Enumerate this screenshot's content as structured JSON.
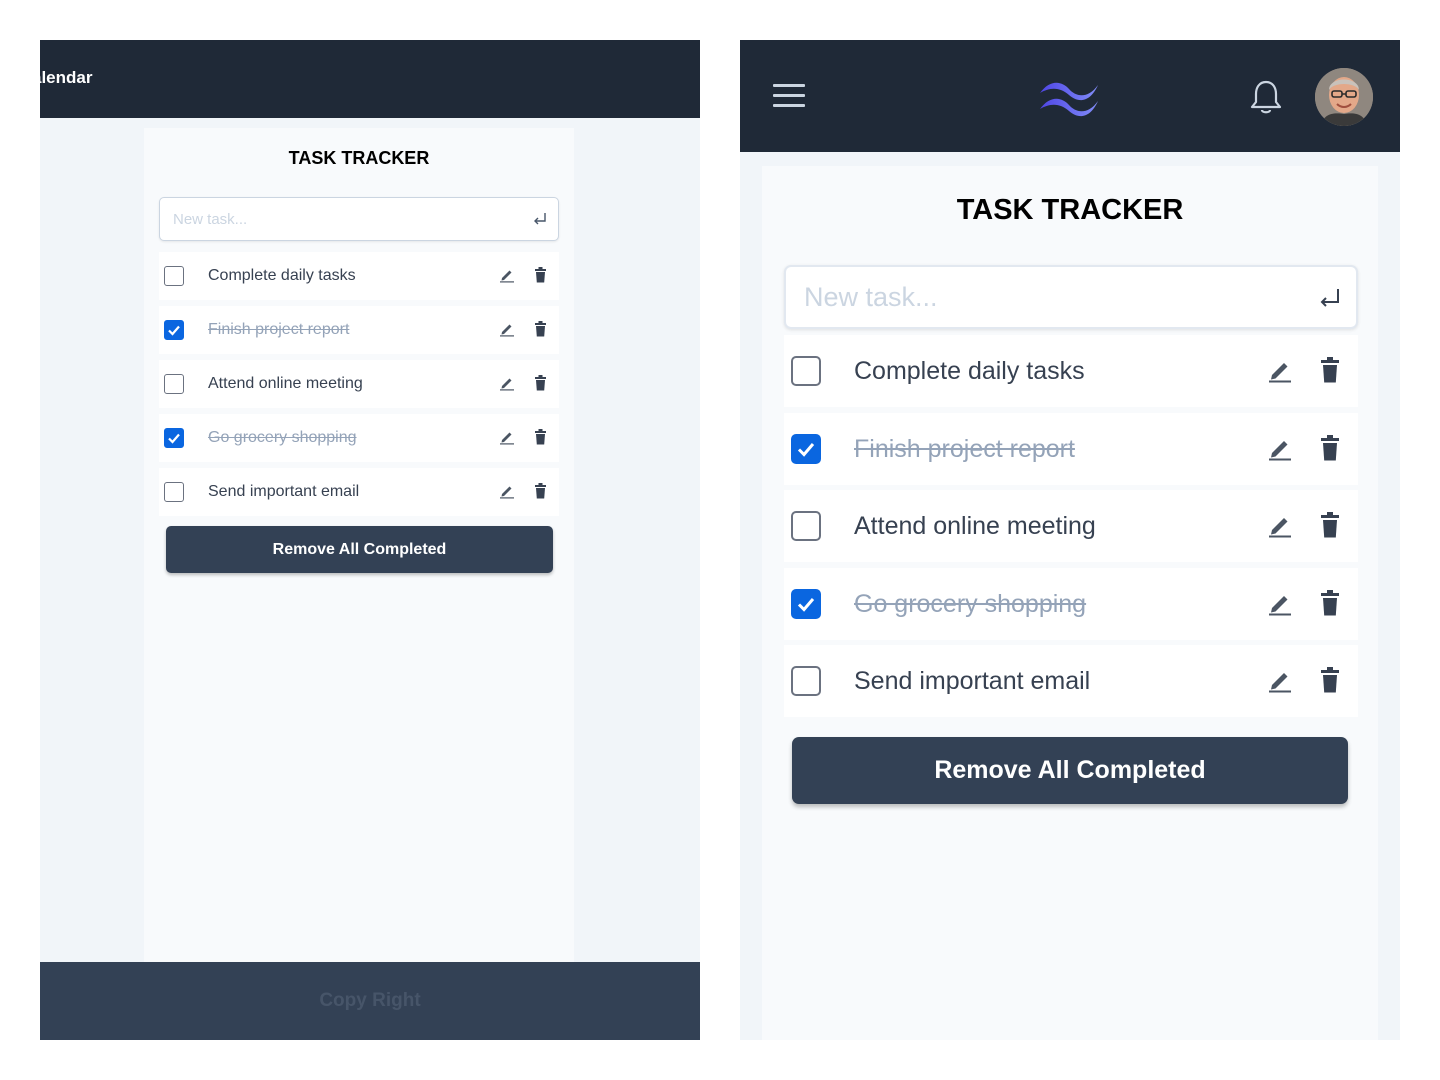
{
  "left": {
    "header": {
      "nav_text": "alendar"
    },
    "title": "TASK TRACKER",
    "input": {
      "placeholder": "New task...",
      "value": ""
    },
    "tasks": [
      {
        "label": "Complete daily tasks",
        "completed": false
      },
      {
        "label": "Finish project report",
        "completed": true
      },
      {
        "label": "Attend online meeting",
        "completed": false
      },
      {
        "label": "Go grocery shopping",
        "completed": true
      },
      {
        "label": "Send important email",
        "completed": false
      }
    ],
    "remove_button": "Remove All Completed",
    "footer": {
      "text": "Copy Right"
    }
  },
  "right": {
    "header": {
      "menu_icon": "hamburger-menu-icon",
      "logo_icon": "tailwind-logo-icon",
      "bell_icon": "bell-icon",
      "avatar": "user-avatar"
    },
    "title": "TASK TRACKER",
    "input": {
      "placeholder": "New task...",
      "value": ""
    },
    "tasks": [
      {
        "label": "Complete daily tasks",
        "completed": false
      },
      {
        "label": "Finish project report",
        "completed": true
      },
      {
        "label": "Attend online meeting",
        "completed": false
      },
      {
        "label": "Go grocery shopping",
        "completed": true
      },
      {
        "label": "Send important email",
        "completed": false
      }
    ],
    "remove_button": "Remove All Completed"
  },
  "icons": {
    "edit": "pencil-icon",
    "delete": "trash-icon",
    "enter": "enter-return-icon",
    "checkbox": "checkmark-icon"
  },
  "colors": {
    "header_bg": "#1f2937",
    "footer_bg": "#334155",
    "button_bg": "#334155",
    "checkbox_checked": "#0a66e0",
    "logo_gradient_start": "#4f46e5",
    "logo_gradient_end": "#818cf8"
  }
}
